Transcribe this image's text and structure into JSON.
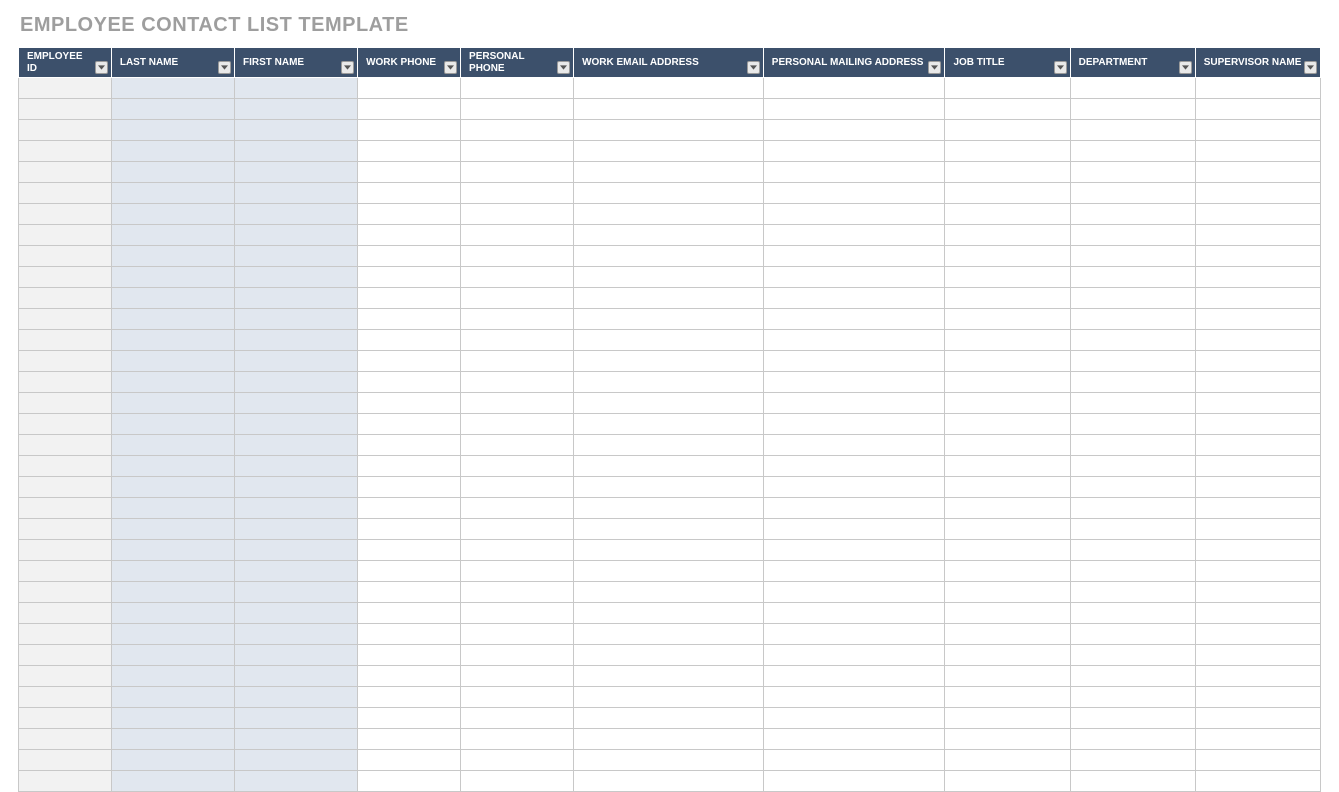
{
  "title": "EMPLOYEE CONTACT LIST TEMPLATE",
  "columns": [
    {
      "label": "EMPLOYEE ID",
      "shade": "gray"
    },
    {
      "label": "LAST NAME",
      "shade": "blue"
    },
    {
      "label": "FIRST NAME",
      "shade": "blue"
    },
    {
      "label": "WORK PHONE",
      "shade": "none"
    },
    {
      "label": "PERSONAL PHONE",
      "shade": "none"
    },
    {
      "label": "WORK EMAIL ADDRESS",
      "shade": "none"
    },
    {
      "label": "PERSONAL MAILING ADDRESS",
      "shade": "none"
    },
    {
      "label": "JOB TITLE",
      "shade": "none"
    },
    {
      "label": "DEPARTMENT",
      "shade": "none"
    },
    {
      "label": "SUPERVISOR NAME",
      "shade": "none"
    }
  ],
  "row_count": 34,
  "rows": []
}
